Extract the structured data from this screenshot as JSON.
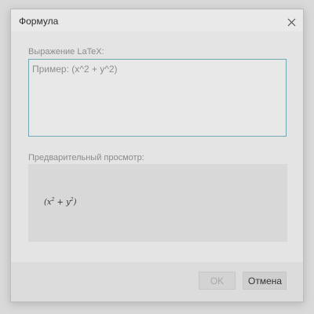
{
  "dialog": {
    "title": "Формула",
    "close_icon": "close-icon"
  },
  "latex": {
    "label": "Выражение LaTeX:",
    "placeholder": "Пример: (x^2 + y^2)",
    "value": ""
  },
  "preview": {
    "label": "Предварительный просмотр:",
    "formula_open": "(",
    "formula_x": "x",
    "formula_x_exp": "2",
    "formula_plus": " + ",
    "formula_y": "y",
    "formula_y_exp": "2",
    "formula_close": ")"
  },
  "buttons": {
    "ok_label": "OK",
    "cancel_label": "Отмена"
  },
  "colors": {
    "input_border": "#6fa8b0",
    "ok_disabled_text": "#a9a9a9"
  }
}
